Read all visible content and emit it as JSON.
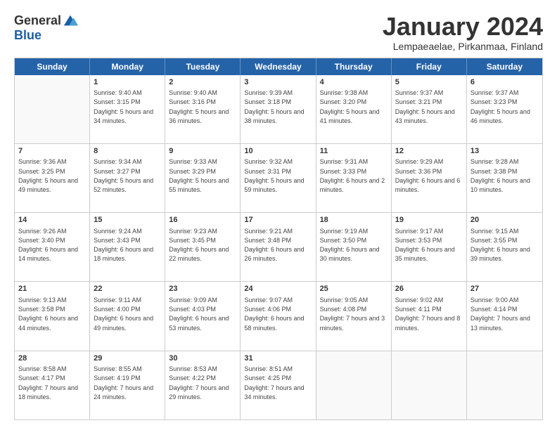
{
  "logo": {
    "general": "General",
    "blue": "Blue"
  },
  "title": "January 2024",
  "subtitle": "Lempaeaelae, Pirkanmaa, Finland",
  "header": {
    "days": [
      "Sunday",
      "Monday",
      "Tuesday",
      "Wednesday",
      "Thursday",
      "Friday",
      "Saturday"
    ]
  },
  "weeks": [
    [
      {
        "day": "",
        "sunrise": "",
        "sunset": "",
        "daylight": ""
      },
      {
        "day": "1",
        "sunrise": "Sunrise: 9:40 AM",
        "sunset": "Sunset: 3:15 PM",
        "daylight": "Daylight: 5 hours and 34 minutes."
      },
      {
        "day": "2",
        "sunrise": "Sunrise: 9:40 AM",
        "sunset": "Sunset: 3:16 PM",
        "daylight": "Daylight: 5 hours and 36 minutes."
      },
      {
        "day": "3",
        "sunrise": "Sunrise: 9:39 AM",
        "sunset": "Sunset: 3:18 PM",
        "daylight": "Daylight: 5 hours and 38 minutes."
      },
      {
        "day": "4",
        "sunrise": "Sunrise: 9:38 AM",
        "sunset": "Sunset: 3:20 PM",
        "daylight": "Daylight: 5 hours and 41 minutes."
      },
      {
        "day": "5",
        "sunrise": "Sunrise: 9:37 AM",
        "sunset": "Sunset: 3:21 PM",
        "daylight": "Daylight: 5 hours and 43 minutes."
      },
      {
        "day": "6",
        "sunrise": "Sunrise: 9:37 AM",
        "sunset": "Sunset: 3:23 PM",
        "daylight": "Daylight: 5 hours and 46 minutes."
      }
    ],
    [
      {
        "day": "7",
        "sunrise": "Sunrise: 9:36 AM",
        "sunset": "Sunset: 3:25 PM",
        "daylight": "Daylight: 5 hours and 49 minutes."
      },
      {
        "day": "8",
        "sunrise": "Sunrise: 9:34 AM",
        "sunset": "Sunset: 3:27 PM",
        "daylight": "Daylight: 5 hours and 52 minutes."
      },
      {
        "day": "9",
        "sunrise": "Sunrise: 9:33 AM",
        "sunset": "Sunset: 3:29 PM",
        "daylight": "Daylight: 5 hours and 55 minutes."
      },
      {
        "day": "10",
        "sunrise": "Sunrise: 9:32 AM",
        "sunset": "Sunset: 3:31 PM",
        "daylight": "Daylight: 5 hours and 59 minutes."
      },
      {
        "day": "11",
        "sunrise": "Sunrise: 9:31 AM",
        "sunset": "Sunset: 3:33 PM",
        "daylight": "Daylight: 6 hours and 2 minutes."
      },
      {
        "day": "12",
        "sunrise": "Sunrise: 9:29 AM",
        "sunset": "Sunset: 3:36 PM",
        "daylight": "Daylight: 6 hours and 6 minutes."
      },
      {
        "day": "13",
        "sunrise": "Sunrise: 9:28 AM",
        "sunset": "Sunset: 3:38 PM",
        "daylight": "Daylight: 6 hours and 10 minutes."
      }
    ],
    [
      {
        "day": "14",
        "sunrise": "Sunrise: 9:26 AM",
        "sunset": "Sunset: 3:40 PM",
        "daylight": "Daylight: 6 hours and 14 minutes."
      },
      {
        "day": "15",
        "sunrise": "Sunrise: 9:24 AM",
        "sunset": "Sunset: 3:43 PM",
        "daylight": "Daylight: 6 hours and 18 minutes."
      },
      {
        "day": "16",
        "sunrise": "Sunrise: 9:23 AM",
        "sunset": "Sunset: 3:45 PM",
        "daylight": "Daylight: 6 hours and 22 minutes."
      },
      {
        "day": "17",
        "sunrise": "Sunrise: 9:21 AM",
        "sunset": "Sunset: 3:48 PM",
        "daylight": "Daylight: 6 hours and 26 minutes."
      },
      {
        "day": "18",
        "sunrise": "Sunrise: 9:19 AM",
        "sunset": "Sunset: 3:50 PM",
        "daylight": "Daylight: 6 hours and 30 minutes."
      },
      {
        "day": "19",
        "sunrise": "Sunrise: 9:17 AM",
        "sunset": "Sunset: 3:53 PM",
        "daylight": "Daylight: 6 hours and 35 minutes."
      },
      {
        "day": "20",
        "sunrise": "Sunrise: 9:15 AM",
        "sunset": "Sunset: 3:55 PM",
        "daylight": "Daylight: 6 hours and 39 minutes."
      }
    ],
    [
      {
        "day": "21",
        "sunrise": "Sunrise: 9:13 AM",
        "sunset": "Sunset: 3:58 PM",
        "daylight": "Daylight: 6 hours and 44 minutes."
      },
      {
        "day": "22",
        "sunrise": "Sunrise: 9:11 AM",
        "sunset": "Sunset: 4:00 PM",
        "daylight": "Daylight: 6 hours and 49 minutes."
      },
      {
        "day": "23",
        "sunrise": "Sunrise: 9:09 AM",
        "sunset": "Sunset: 4:03 PM",
        "daylight": "Daylight: 6 hours and 53 minutes."
      },
      {
        "day": "24",
        "sunrise": "Sunrise: 9:07 AM",
        "sunset": "Sunset: 4:06 PM",
        "daylight": "Daylight: 6 hours and 58 minutes."
      },
      {
        "day": "25",
        "sunrise": "Sunrise: 9:05 AM",
        "sunset": "Sunset: 4:08 PM",
        "daylight": "Daylight: 7 hours and 3 minutes."
      },
      {
        "day": "26",
        "sunrise": "Sunrise: 9:02 AM",
        "sunset": "Sunset: 4:11 PM",
        "daylight": "Daylight: 7 hours and 8 minutes."
      },
      {
        "day": "27",
        "sunrise": "Sunrise: 9:00 AM",
        "sunset": "Sunset: 4:14 PM",
        "daylight": "Daylight: 7 hours and 13 minutes."
      }
    ],
    [
      {
        "day": "28",
        "sunrise": "Sunrise: 8:58 AM",
        "sunset": "Sunset: 4:17 PM",
        "daylight": "Daylight: 7 hours and 18 minutes."
      },
      {
        "day": "29",
        "sunrise": "Sunrise: 8:55 AM",
        "sunset": "Sunset: 4:19 PM",
        "daylight": "Daylight: 7 hours and 24 minutes."
      },
      {
        "day": "30",
        "sunrise": "Sunrise: 8:53 AM",
        "sunset": "Sunset: 4:22 PM",
        "daylight": "Daylight: 7 hours and 29 minutes."
      },
      {
        "day": "31",
        "sunrise": "Sunrise: 8:51 AM",
        "sunset": "Sunset: 4:25 PM",
        "daylight": "Daylight: 7 hours and 34 minutes."
      },
      {
        "day": "",
        "sunrise": "",
        "sunset": "",
        "daylight": ""
      },
      {
        "day": "",
        "sunrise": "",
        "sunset": "",
        "daylight": ""
      },
      {
        "day": "",
        "sunrise": "",
        "sunset": "",
        "daylight": ""
      }
    ]
  ]
}
